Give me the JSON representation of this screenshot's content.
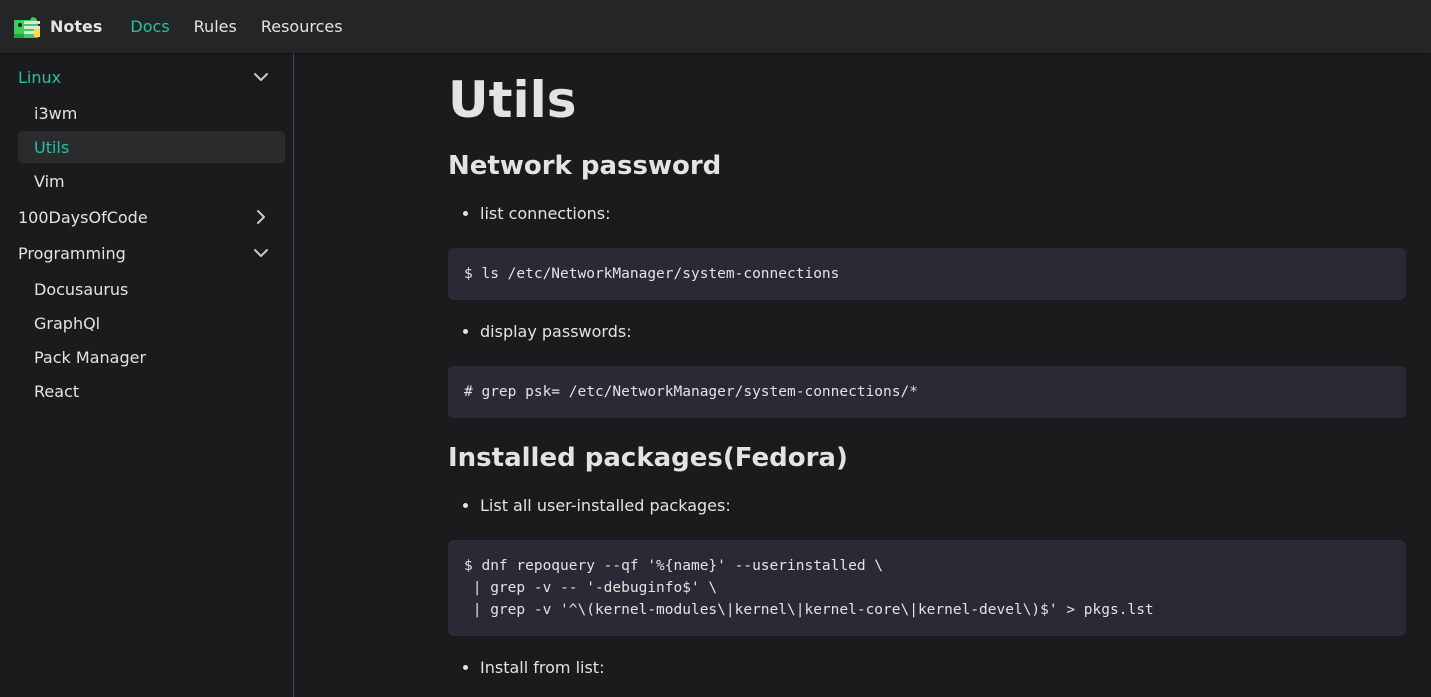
{
  "navbar": {
    "brand": "Notes",
    "links": [
      {
        "label": "Docs",
        "active": true
      },
      {
        "label": "Rules",
        "active": false
      },
      {
        "label": "Resources",
        "active": false
      }
    ]
  },
  "sidebar": {
    "linux": "Linux",
    "linux_items": [
      "i3wm",
      "Utils",
      "Vim"
    ],
    "days": "100DaysOfCode",
    "programming": "Programming",
    "programming_items": [
      "Docusaurus",
      "GraphQl",
      "Pack Manager",
      "React"
    ]
  },
  "article": {
    "title": "Utils",
    "section1": "Network password",
    "bullet1": "list connections:",
    "code1": "$ ls /etc/NetworkManager/system-connections",
    "bullet2": "display passwords:",
    "code2": "# grep psk= /etc/NetworkManager/system-connections/*",
    "section2": "Installed packages(Fedora)",
    "bullet3": "List all user-installed packages:",
    "code3": "$ dnf repoquery --qf '%{name}' --userinstalled \\\n | grep -v -- '-debuginfo$' \\\n | grep -v '^\\(kernel-modules\\|kernel\\|kernel-core\\|kernel-devel\\)$' > pkgs.lst",
    "bullet4": "Install from list:"
  },
  "colors": {
    "accent": "#25c2a0",
    "background": "#1b1b1d",
    "navbar": "#242526",
    "code_bg": "#292a35"
  }
}
